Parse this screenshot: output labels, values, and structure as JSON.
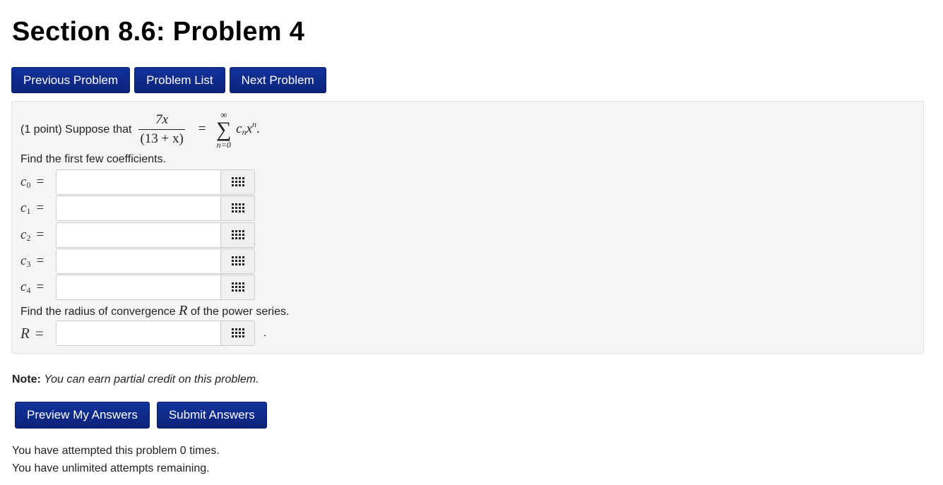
{
  "page": {
    "title": "Section 8.6: Problem 4"
  },
  "nav": {
    "previous_label": "Previous Problem",
    "list_label": "Problem List",
    "next_label": "Next Problem"
  },
  "problem": {
    "intro": "(1 point) Suppose that",
    "fraction_numerator": "7x",
    "fraction_denominator": "(13 + x)",
    "equals": "=",
    "sum_upper": "∞",
    "sum_symbol": "∑",
    "sum_lower": "n=0",
    "term_base": "c",
    "term_sub": "n",
    "term_var": "x",
    "term_sup": "n",
    "term_end": ".",
    "find_coefficients": "Find the first few coefficients.",
    "coefficients": [
      {
        "var": "c",
        "sub": "0",
        "eq": "=",
        "value": ""
      },
      {
        "var": "c",
        "sub": "1",
        "eq": "=",
        "value": ""
      },
      {
        "var": "c",
        "sub": "2",
        "eq": "=",
        "value": ""
      },
      {
        "var": "c",
        "sub": "3",
        "eq": "=",
        "value": ""
      },
      {
        "var": "c",
        "sub": "4",
        "eq": "=",
        "value": ""
      }
    ],
    "radius_prefix": "Find the radius of convergence",
    "radius_var": "R",
    "radius_suffix": "of the power series.",
    "radius_label": "R",
    "radius_eq": "=",
    "radius_value": "",
    "radius_period": ".",
    "toolbar_icon": "grid-icon"
  },
  "note": {
    "label": "Note:",
    "text": "You can earn partial credit on this problem."
  },
  "actions": {
    "preview_label": "Preview My Answers",
    "submit_label": "Submit Answers"
  },
  "status": {
    "attempted": "You have attempted this problem 0 times.",
    "remaining": "You have unlimited attempts remaining."
  },
  "colors": {
    "button_bg": "#0f2b8f",
    "panel_bg": "#f5f5f5"
  }
}
